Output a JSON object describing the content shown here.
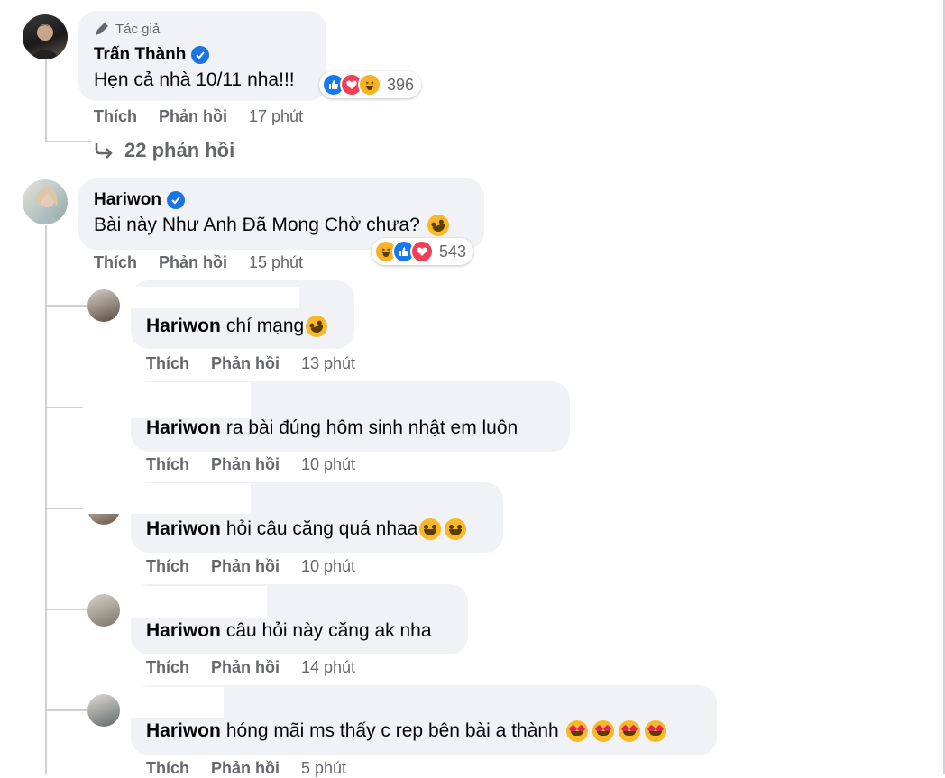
{
  "main_comment_1": {
    "author_badge": "Tác giả",
    "author": "Trấn Thành",
    "text": "Hẹn cả nhà 10/11 nha!!!",
    "reaction_count": "396",
    "reactions": [
      "like-icon",
      "love-icon",
      "haha-icon"
    ],
    "like_label": "Thích",
    "reply_label": "Phản hồi",
    "time": "17 phút",
    "view_replies": "22 phản hồi"
  },
  "main_comment_2": {
    "author": "Hariwon",
    "text": "Bài này Như Anh Đã Mong Chờ chưa?",
    "reaction_count": "543",
    "reactions": [
      "haha-icon",
      "like-icon",
      "love-icon"
    ],
    "like_label": "Thích",
    "reply_label": "Phản hồi",
    "time": "15 phút"
  },
  "replies": [
    {
      "mention": "Hariwon",
      "text": "chí mạng",
      "like_label": "Thích",
      "reply_label": "Phản hồi",
      "time": "13 phút"
    },
    {
      "mention": "Hariwon",
      "text": "ra bài đúng hôm sinh nhật em luôn",
      "like_label": "Thích",
      "reply_label": "Phản hồi",
      "time": "10 phút"
    },
    {
      "mention": "Hariwon",
      "text": "hỏi câu căng quá nhaa",
      "like_label": "Thích",
      "reply_label": "Phản hồi",
      "time": "10 phút"
    },
    {
      "mention": "Hariwon",
      "text": "câu hỏi này căng ak nha",
      "like_label": "Thích",
      "reply_label": "Phản hồi",
      "time": "14 phút"
    },
    {
      "mention": "Hariwon",
      "text": "hóng mãi ms thấy c rep bên bài a thành",
      "like_label": "Thích",
      "reply_label": "Phản hồi",
      "time": "5 phút"
    }
  ],
  "colors": {
    "bubble": "#f0f2f5",
    "meta_text": "#65676b",
    "verified": "#1b74e4",
    "like": "#1877f2",
    "love": "#f33e58",
    "haha": "#f7b125"
  }
}
